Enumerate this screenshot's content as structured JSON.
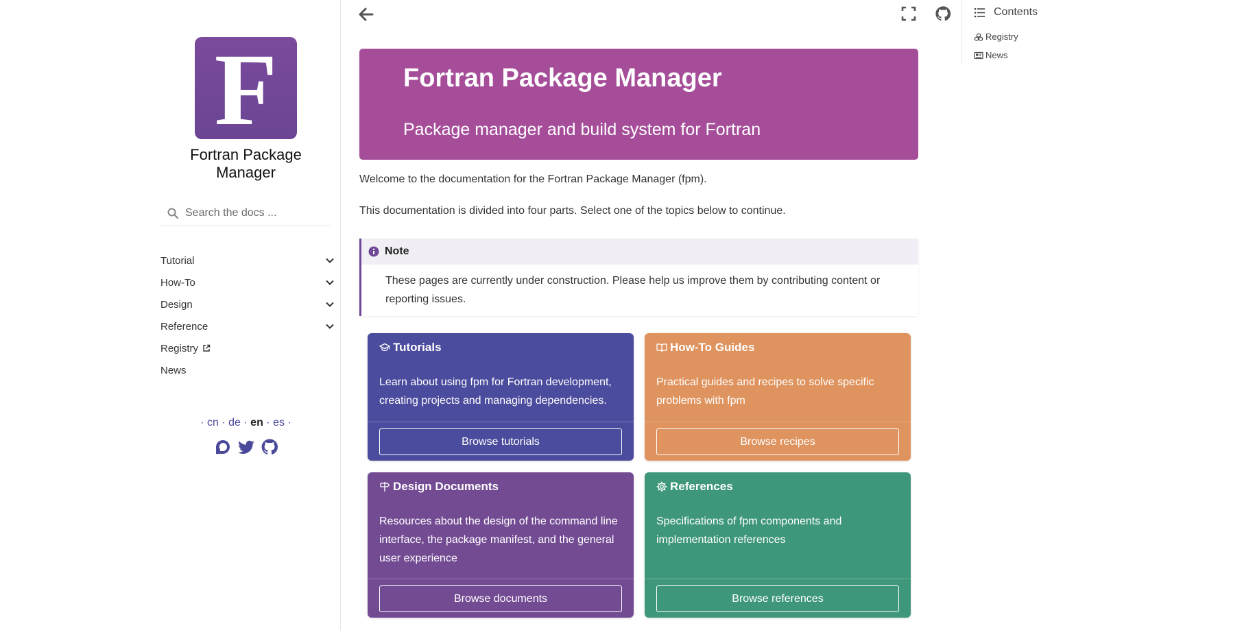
{
  "sidebar": {
    "logo_letter": "F",
    "site_title": "Fortran Package Manager",
    "search": {
      "placeholder": "Search the docs ..."
    },
    "nav": [
      {
        "label": "Tutorial",
        "expandable": true
      },
      {
        "label": "How-To",
        "expandable": true
      },
      {
        "label": "Design",
        "expandable": true
      },
      {
        "label": "Reference",
        "expandable": true
      },
      {
        "label": "Registry",
        "external": true
      },
      {
        "label": "News"
      }
    ],
    "languages": {
      "sep": "·",
      "items": [
        "cn",
        "de",
        "en",
        "es"
      ],
      "current": "en"
    },
    "socials": [
      "discourse-icon",
      "twitter-icon",
      "github-icon"
    ]
  },
  "topbar": {
    "icons": [
      "arrow-left-icon",
      "fullscreen-icon",
      "github-icon"
    ]
  },
  "hero": {
    "title": "Fortran Package Manager",
    "subtitle": "Package manager and build system for Fortran",
    "color": "#a64d9a"
  },
  "intro": {
    "p1": "Welcome to the documentation for the Fortran Package Manager (fpm).",
    "p2": "This documentation is divided into four parts. Select one of the topics below to continue."
  },
  "note": {
    "title": "Note",
    "text": "These pages are currently under construction. Please help us improve them by contributing content or reporting issues."
  },
  "cards": [
    {
      "title": "Tutorials",
      "text": "Learn about using fpm for Fortran development, creating projects and managing dependencies.",
      "button": "Browse tutorials",
      "icon": "graduation-cap-icon",
      "color": "#4b4c9d"
    },
    {
      "title": "How-To Guides",
      "text": "Practical guides and recipes to solve specific problems with fpm",
      "button": "Browse recipes",
      "icon": "book-open-icon",
      "color": "#df935e"
    },
    {
      "title": "Design Documents",
      "text": "Resources about the design of the command line interface, the package manifest, and the general user experience",
      "button": "Browse documents",
      "icon": "signpost-icon",
      "color": "#734b93"
    },
    {
      "title": "References",
      "text": "Specifications of fpm components and implementation references",
      "button": "Browse references",
      "icon": "gear-icon",
      "color": "#3f977b"
    }
  ],
  "toc": {
    "title": "Contents",
    "items": [
      {
        "label": "Registry",
        "icon": "cubes-icon"
      },
      {
        "label": "News",
        "icon": "newspaper-icon"
      }
    ]
  },
  "colors": {
    "accent": "#4b4a9a",
    "brand": "#6e4796"
  }
}
